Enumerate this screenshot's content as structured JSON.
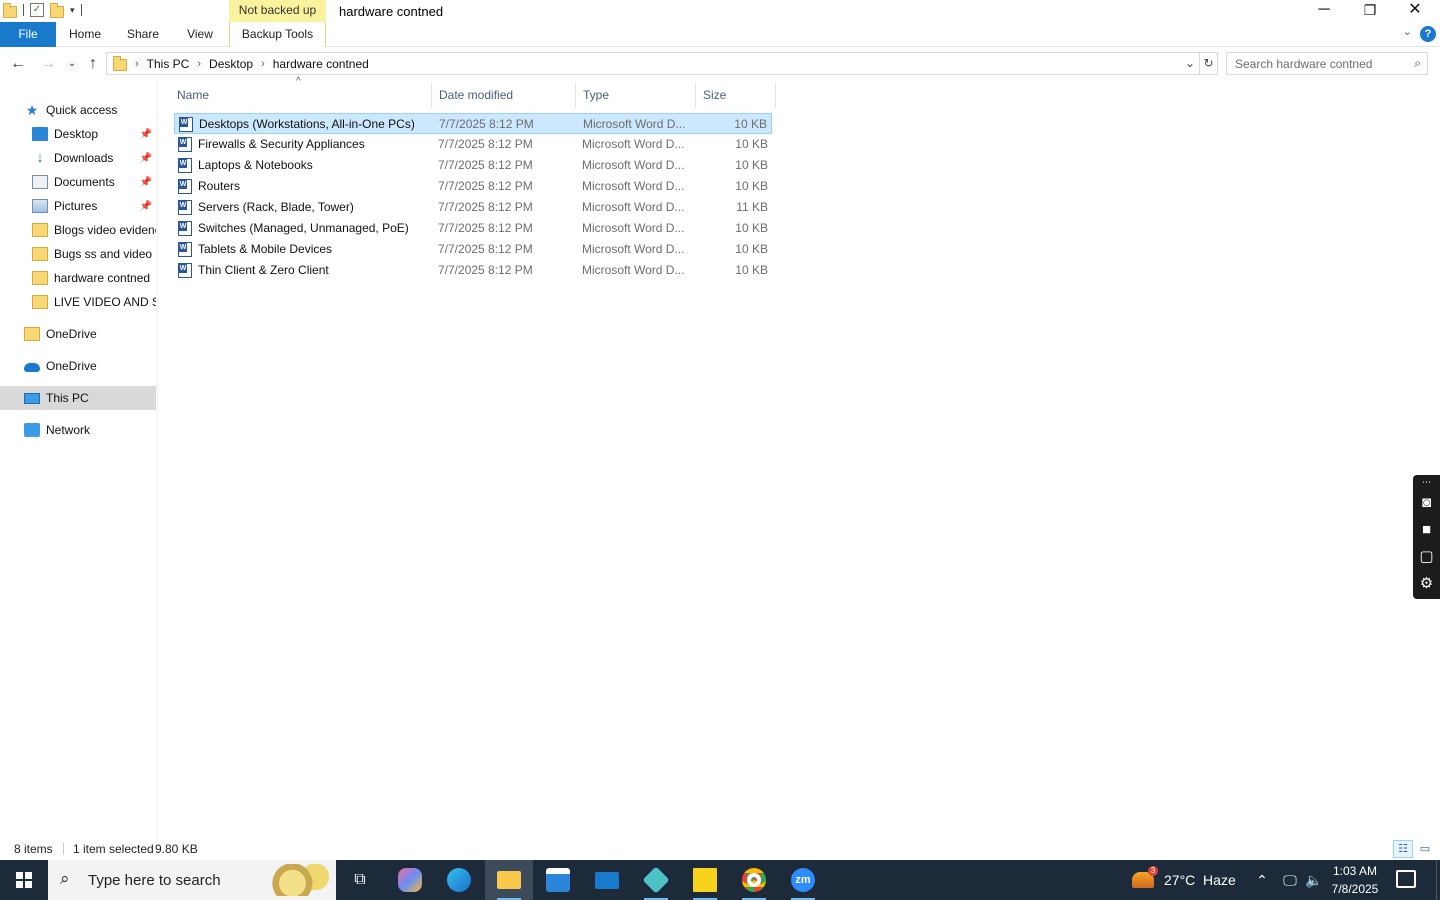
{
  "window": {
    "title": "hardware contned",
    "context_tab": "Not backed up",
    "controls": {
      "minimize": "─",
      "restore": "❐",
      "close": "✕"
    }
  },
  "ribbon": {
    "tabs": [
      "File",
      "Home",
      "Share",
      "View",
      "Backup Tools"
    ],
    "help": "?"
  },
  "address": {
    "crumbs": [
      "This PC",
      "Desktop",
      "hardware contned"
    ],
    "search_placeholder": "Search hardware contned"
  },
  "nav_pane": [
    {
      "label": "Quick access",
      "icon": "star-icon",
      "pinned": false
    },
    {
      "label": "Desktop",
      "icon": "desktop-icon",
      "pinned": true
    },
    {
      "label": "Downloads",
      "icon": "download-icon",
      "pinned": true
    },
    {
      "label": "Documents",
      "icon": "documents-icon",
      "pinned": true
    },
    {
      "label": "Pictures",
      "icon": "pictures-icon",
      "pinned": true
    },
    {
      "label": "Blogs video evidenc",
      "icon": "folder-icon",
      "pinned": false
    },
    {
      "label": "Bugs ss and  video",
      "icon": "folder-icon",
      "pinned": false
    },
    {
      "label": "hardware contned",
      "icon": "folder-icon",
      "pinned": false
    },
    {
      "label": "LIVE VIDEO AND SS",
      "icon": "folder-icon",
      "pinned": false
    },
    {
      "label": "OneDrive",
      "icon": "folder-icon",
      "pinned": false
    },
    {
      "label": "OneDrive",
      "icon": "cloud-icon",
      "pinned": false
    },
    {
      "label": "This PC",
      "icon": "computer-icon",
      "pinned": false,
      "selected": true
    },
    {
      "label": "Network",
      "icon": "network-icon",
      "pinned": false
    }
  ],
  "columns": [
    "Name",
    "Date modified",
    "Type",
    "Size"
  ],
  "files": [
    {
      "name": "Desktops (Workstations, All-in-One PCs)",
      "date": "7/7/2025 8:12 PM",
      "type": "Microsoft Word D...",
      "size": "10 KB",
      "selected": true
    },
    {
      "name": "Firewalls & Security Appliances",
      "date": "7/7/2025 8:12 PM",
      "type": "Microsoft Word D...",
      "size": "10 KB"
    },
    {
      "name": "Laptops & Notebooks",
      "date": "7/7/2025 8:12 PM",
      "type": "Microsoft Word D...",
      "size": "10 KB"
    },
    {
      "name": "Routers",
      "date": "7/7/2025 8:12 PM",
      "type": "Microsoft Word D...",
      "size": "10 KB"
    },
    {
      "name": "Servers (Rack, Blade, Tower)",
      "date": "7/7/2025 8:12 PM",
      "type": "Microsoft Word D...",
      "size": "11 KB"
    },
    {
      "name": "Switches (Managed, Unmanaged, PoE)",
      "date": "7/7/2025 8:12 PM",
      "type": "Microsoft Word D...",
      "size": "10 KB"
    },
    {
      "name": "Tablets & Mobile Devices",
      "date": "7/7/2025 8:12 PM",
      "type": "Microsoft Word D...",
      "size": "10 KB"
    },
    {
      "name": "Thin Client & Zero Client",
      "date": "7/7/2025 8:12 PM",
      "type": "Microsoft Word D...",
      "size": "10 KB"
    }
  ],
  "status": {
    "items": "8 items",
    "selected": "1 item selected",
    "size": "9.80 KB"
  },
  "taskbar": {
    "search_placeholder": "Type here to search",
    "weather": "27°C  Haze",
    "weather_badge": "3",
    "time": "1:03 AM",
    "date": "7/8/2025",
    "zoom_label": "zm"
  },
  "colors": {
    "accent": "#1979ca",
    "selection": "#cce8ff",
    "taskbar": "#1c2a3a"
  }
}
